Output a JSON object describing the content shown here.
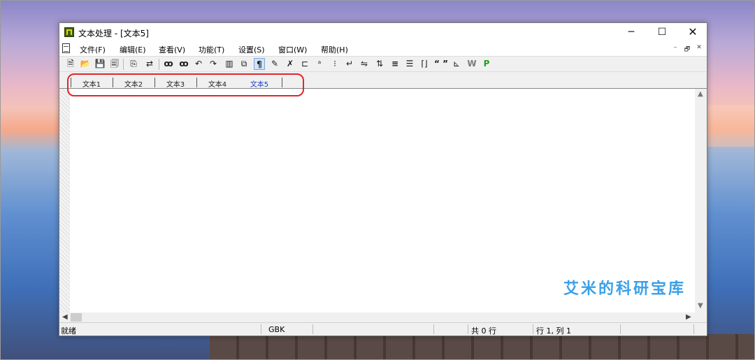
{
  "window": {
    "title": "文本处理 - [文本5]",
    "controls": {
      "minimize": "─",
      "maximize": "☐",
      "close": "✕"
    }
  },
  "menu": {
    "items": [
      "文件(F)",
      "编辑(E)",
      "查看(V)",
      "功能(T)",
      "设置(S)",
      "窗口(W)",
      "帮助(H)"
    ],
    "mdi": {
      "minimize": "–",
      "restore": "🗗",
      "close": "✕"
    }
  },
  "toolbar": {
    "buttons": [
      {
        "name": "new-file",
        "glyph": "🗎"
      },
      {
        "name": "open",
        "glyph": "📂"
      },
      {
        "name": "save",
        "glyph": "💾"
      },
      {
        "name": "save-all",
        "glyph": "🗐"
      },
      {
        "name": "copy-special",
        "glyph": "⎘"
      },
      {
        "name": "replace-special",
        "glyph": "⇄"
      },
      {
        "name": "find",
        "glyph": "ꝏ"
      },
      {
        "name": "find-replace",
        "glyph": "ꝏ"
      },
      {
        "name": "undo",
        "glyph": "↶"
      },
      {
        "name": "redo",
        "glyph": "↷"
      },
      {
        "name": "columns",
        "glyph": "▥"
      },
      {
        "name": "copy",
        "glyph": "⧉"
      },
      {
        "name": "paragraph",
        "glyph": "¶"
      },
      {
        "name": "tool",
        "glyph": "✎"
      },
      {
        "name": "spell",
        "glyph": "✗"
      },
      {
        "name": "format-a",
        "glyph": "⊏"
      },
      {
        "name": "format-b",
        "glyph": "ᵃ"
      },
      {
        "name": "dots",
        "glyph": "⁝"
      },
      {
        "name": "wrap",
        "glyph": "↵"
      },
      {
        "name": "swap",
        "glyph": "⇋"
      },
      {
        "name": "sort",
        "glyph": "⇅"
      },
      {
        "name": "align",
        "glyph": "≡"
      },
      {
        "name": "list",
        "glyph": "☰"
      },
      {
        "name": "brackets",
        "glyph": "⌈⌋"
      },
      {
        "name": "quotes",
        "glyph": "“ ”"
      },
      {
        "name": "chart",
        "glyph": "⊾"
      },
      {
        "name": "word",
        "glyph": "W"
      },
      {
        "name": "p-tool",
        "glyph": "P"
      }
    ]
  },
  "tabs": [
    {
      "label": "文本1",
      "active": false
    },
    {
      "label": "文本2",
      "active": false
    },
    {
      "label": "文本3",
      "active": false
    },
    {
      "label": "文本4",
      "active": false
    },
    {
      "label": "文本5",
      "active": true
    }
  ],
  "watermark": "艾米的科研宝库",
  "status": {
    "ready": "就绪",
    "encoding": "GBK",
    "lines": "共 0 行",
    "position": "行 1, 列 1"
  },
  "colors": {
    "highlight_ring": "#e0262b",
    "active_tab": "#1a3fd0",
    "watermark": "#3aa0e8"
  }
}
